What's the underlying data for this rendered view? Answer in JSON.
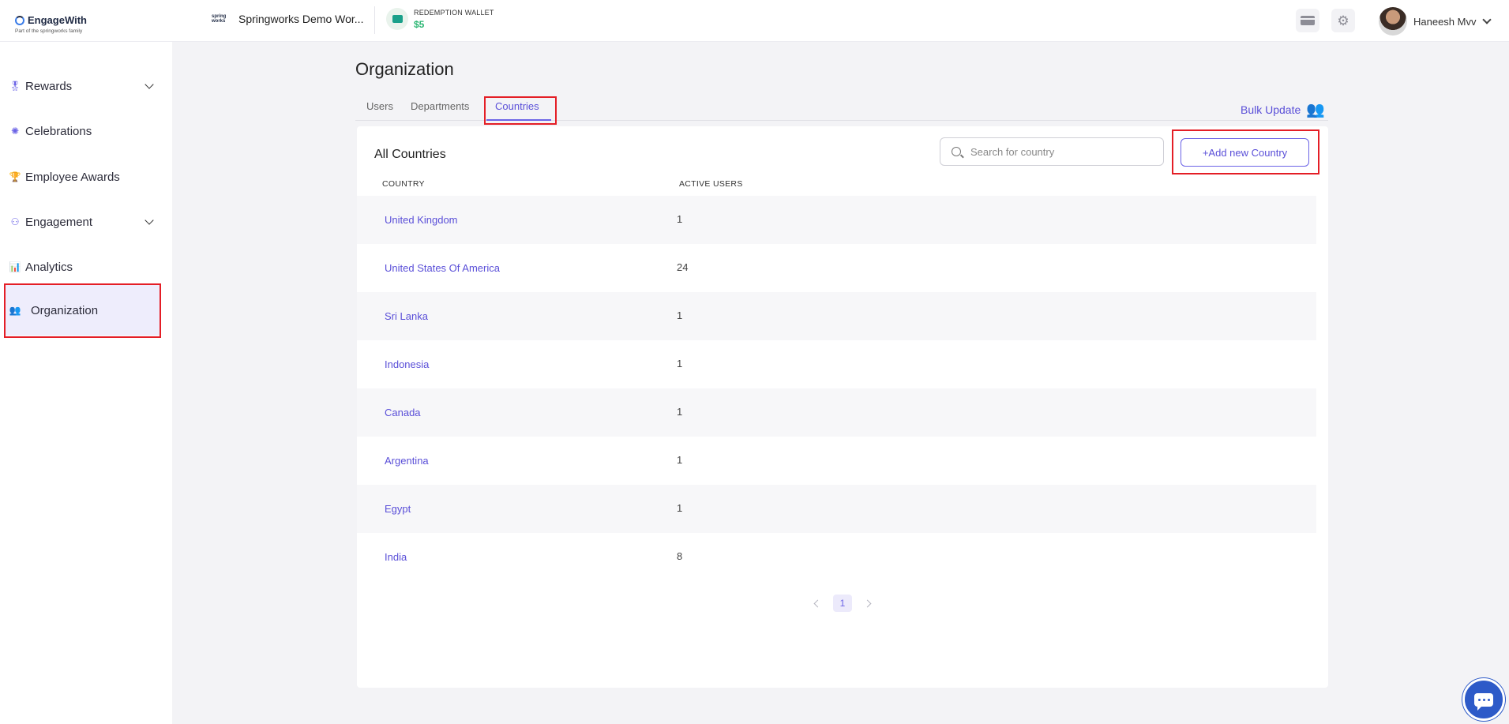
{
  "brand": {
    "name": "EngageWith",
    "tagline": "Part of the springworks family"
  },
  "workspace": {
    "logo_text": "spring works",
    "name": "Springworks Demo Wor..."
  },
  "wallet": {
    "label": "REDEMPTION WALLET",
    "amount": "$5"
  },
  "user": {
    "name": "Haneesh Mvv"
  },
  "sidebar": {
    "items": [
      {
        "label": "Rewards",
        "icon": "medal-icon",
        "expandable": true
      },
      {
        "label": "Celebrations",
        "icon": "party-icon",
        "expandable": false
      },
      {
        "label": "Employee Awards",
        "icon": "trophy-icon",
        "expandable": false
      },
      {
        "label": "Engagement",
        "icon": "engagement-icon",
        "expandable": true
      },
      {
        "label": "Analytics",
        "icon": "analytics-icon",
        "expandable": false
      },
      {
        "label": "Organization",
        "icon": "people-icon",
        "expandable": false,
        "active": true
      }
    ]
  },
  "page": {
    "title": "Organization",
    "tabs": [
      {
        "label": "Users"
      },
      {
        "label": "Departments"
      },
      {
        "label": "Countries",
        "active": true
      }
    ],
    "bulk_update_label": "Bulk Update"
  },
  "countries": {
    "title": "All Countries",
    "search_placeholder": "Search for country",
    "add_button_label": "+Add new Country",
    "columns": [
      "COUNTRY",
      "ACTIVE USERS"
    ],
    "rows": [
      {
        "country": "United Kingdom",
        "active_users": "1"
      },
      {
        "country": "United States Of America",
        "active_users": "24"
      },
      {
        "country": "Sri Lanka",
        "active_users": "1"
      },
      {
        "country": "Indonesia",
        "active_users": "1"
      },
      {
        "country": "Canada",
        "active_users": "1"
      },
      {
        "country": "Argentina",
        "active_users": "1"
      },
      {
        "country": "Egypt",
        "active_users": "1"
      },
      {
        "country": "India",
        "active_users": "8"
      }
    ],
    "current_page": "1"
  },
  "colors": {
    "accent": "#5a4fd8",
    "highlight": "#e41e26",
    "chat": "#2d5ac8"
  }
}
